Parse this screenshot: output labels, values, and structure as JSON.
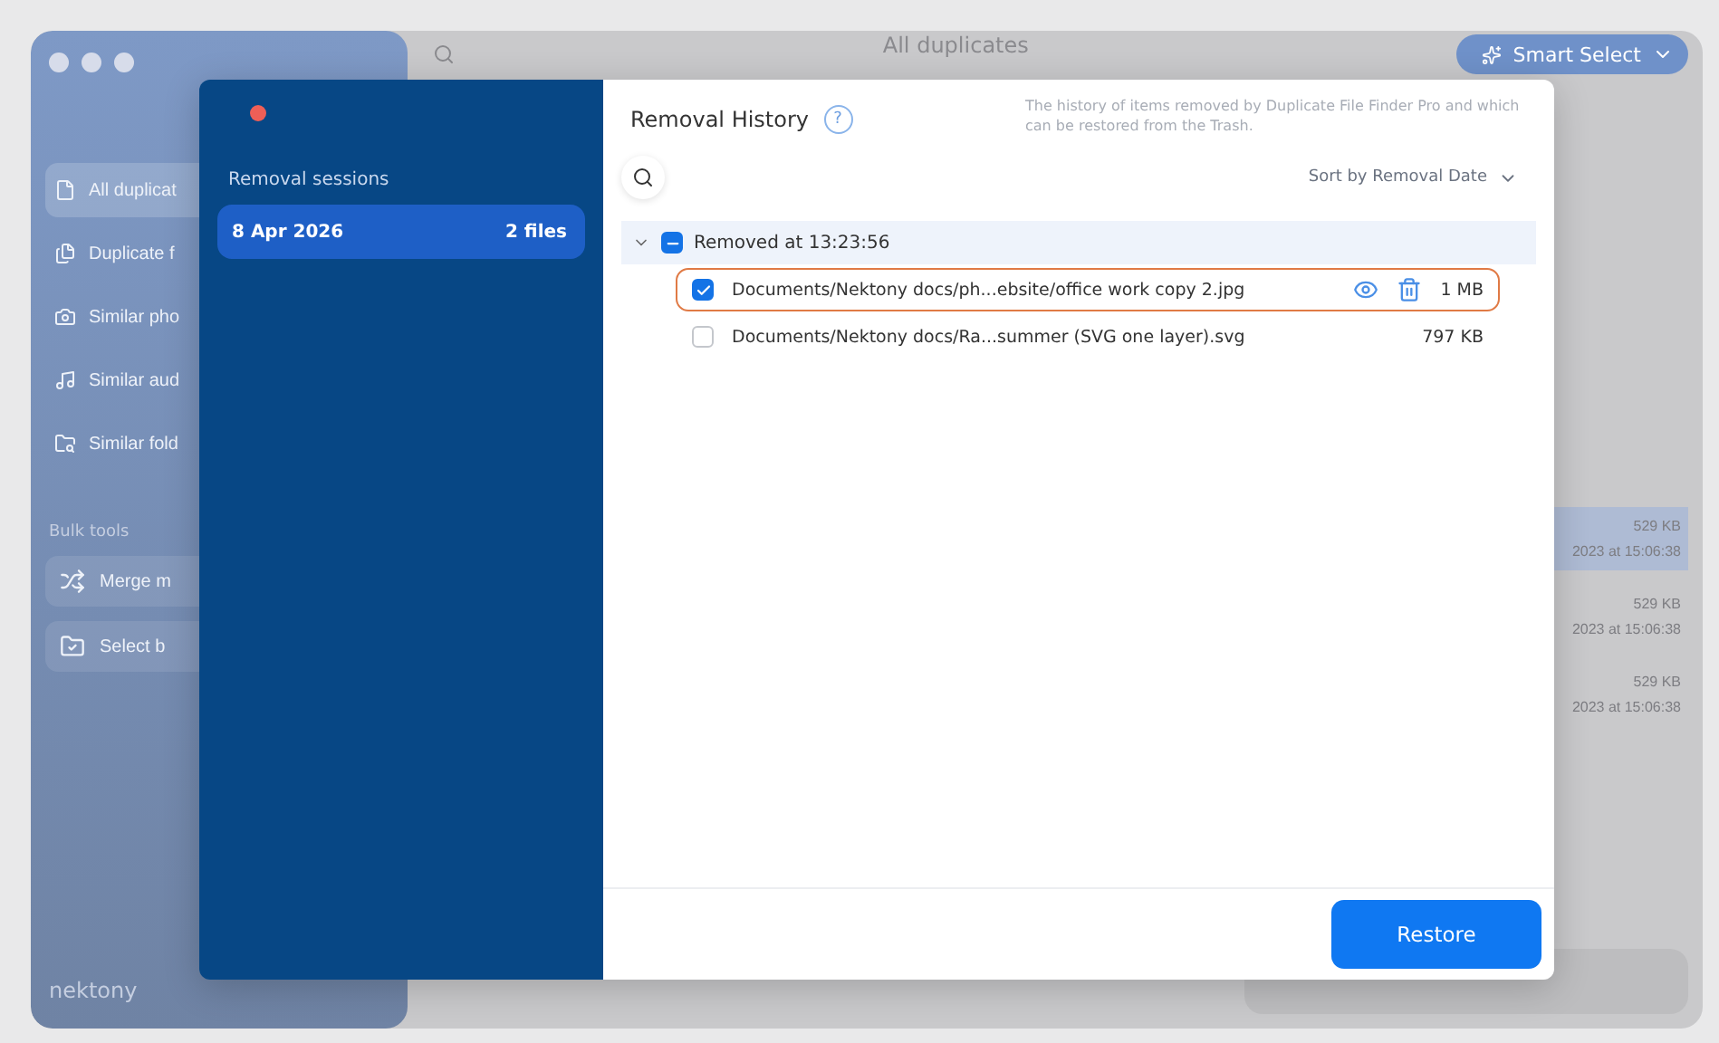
{
  "app": {
    "sidebar": {
      "items": [
        {
          "label": "All duplicat",
          "selected": true
        },
        {
          "label": "Duplicate f",
          "selected": false
        },
        {
          "label": "Similar pho",
          "selected": false
        },
        {
          "label": "Similar aud",
          "selected": false
        },
        {
          "label": "Similar fold",
          "selected": false
        }
      ],
      "bulk_title": "Bulk tools",
      "bulk_tools": [
        {
          "label": "Merge m"
        },
        {
          "label": "Select b"
        }
      ],
      "logo": "nektony"
    },
    "title": "All duplicates",
    "smart_select": "Smart Select",
    "rows": [
      {
        "size": "529 KB",
        "date": "2023 at 15:06:38",
        "selected": true
      },
      {
        "size": "529 KB",
        "date": "2023 at 15:06:38",
        "selected": false
      },
      {
        "size": "529 KB",
        "date": "2023 at 15:06:38",
        "selected": false
      }
    ]
  },
  "dialog": {
    "sessions_title": "Removal sessions",
    "sessions": [
      {
        "date": "8 Apr 2026",
        "count": "2 files",
        "selected": true
      }
    ],
    "title": "Removal History",
    "help": "?",
    "description": "The history of items removed by Duplicate File Finder Pro and which can be restored from the Trash.",
    "sort": "Sort by Removal Date",
    "groups": [
      {
        "label": "Removed at 13:23:56",
        "expanded": true,
        "partial": true,
        "files": [
          {
            "path": "Documents/Nektony docs/ph...ebsite/office work copy 2.jpg",
            "size": "1 MB",
            "checked": true,
            "selected": true
          },
          {
            "path": "Documents/Nektony docs/Ra...summer (SVG one layer).svg",
            "size": "797 KB",
            "checked": false,
            "selected": false
          }
        ]
      }
    ],
    "restore": "Restore"
  }
}
